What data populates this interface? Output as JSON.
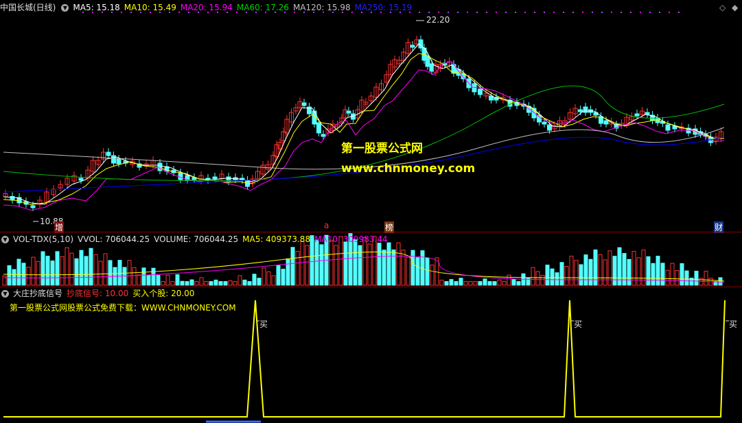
{
  "main_header": {
    "stock": "中国长城(日线)",
    "ma5": "MA5: 15.18",
    "ma10": "MA10: 15.49",
    "ma20": "MA20: 15.94",
    "ma60": "MA60: 17.26",
    "ma120": "MA120: 15.98",
    "ma250": "MA250: 15.19"
  },
  "price_labels": {
    "high": "22.20",
    "low": "10.88"
  },
  "watermark": {
    "line1": "第一股票公式网",
    "line2": "www.chnmoney.com"
  },
  "event_markers": {
    "zeng": "增",
    "ba": "a",
    "bang": "榜",
    "cai": "财"
  },
  "vol_header": {
    "name": "VOL-TDX(5,10)",
    "vvol": "VVOL: 706044.25",
    "volume": "VOLUME: 706044.25",
    "ma5": "MA5: 409373.88",
    "ma10": "MA10: 309983.44"
  },
  "ind_header": {
    "name": "大庄抄底信号",
    "signal": "抄底信号: 10.00",
    "buy": "买入个股: 20.00",
    "promo": "第一股票公式网股票公式免费下载：WWW.CHNMONEY.COM"
  },
  "buy_label": "买",
  "colors": {
    "up": "#ff3232",
    "down": "#54ffff",
    "ma5": "#ffffff",
    "ma10": "#ffff00",
    "ma20": "#ff00ff",
    "ma60": "#00c000",
    "ma120": "#c0c0c0",
    "ma250": "#0000ff",
    "signal": "#ffff00"
  }
}
